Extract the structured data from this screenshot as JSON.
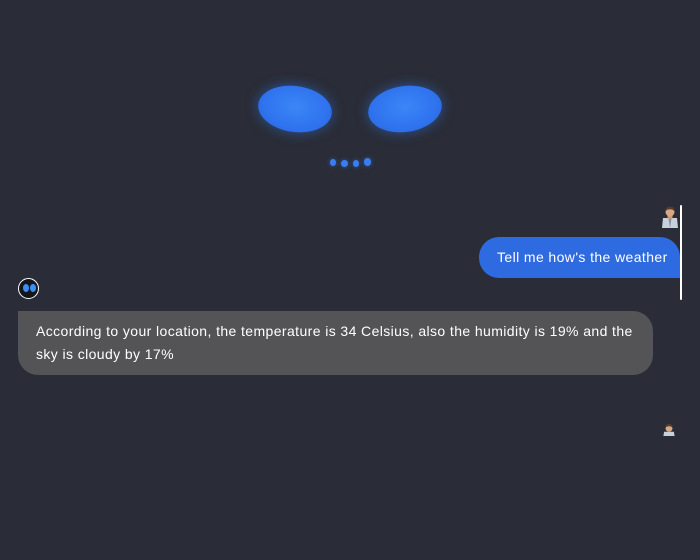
{
  "assistant": {
    "name": "",
    "colors": {
      "background": "#2a2d37",
      "eye": "#2f73ee",
      "user_bubble": "#2e6ae0",
      "bot_bubble": "#545457"
    }
  },
  "chat": {
    "messages": [
      {
        "role": "user",
        "avatar_icon": "user-avatar-icon",
        "text": "Tell me how's the weather"
      },
      {
        "role": "bot",
        "avatar_icon": "robot-eyes-icon",
        "text": "According to your location, the temperature is 34 Celsius, also the humidity is 19% and the sky is cloudy by 17%"
      }
    ],
    "typing_user_avatar_icon": "user-avatar-icon"
  }
}
